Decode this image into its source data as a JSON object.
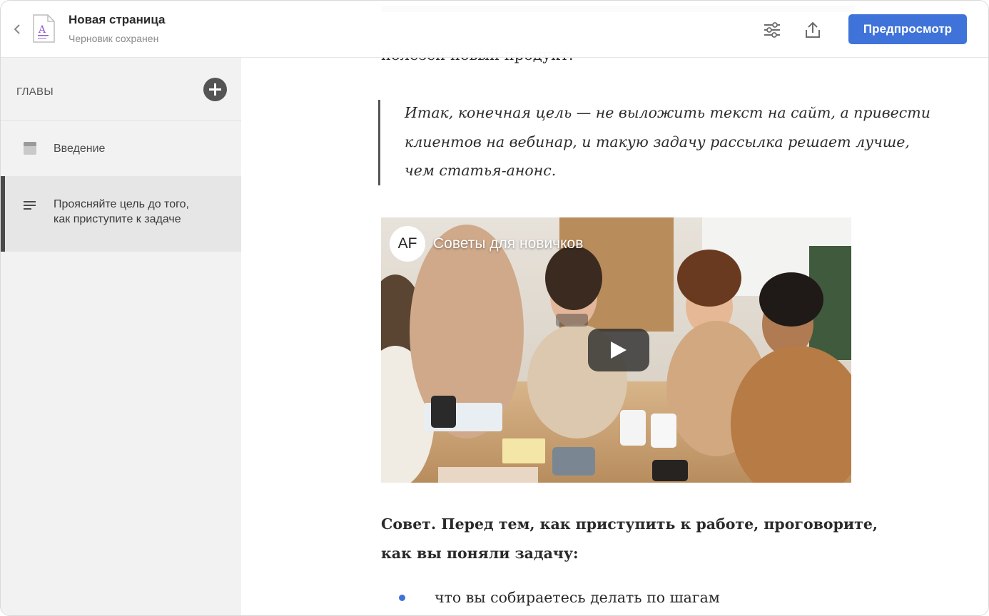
{
  "header": {
    "title": "Новая страница",
    "subtitle": "Черновик сохранен",
    "preview_label": "Предпросмотр",
    "doc_icon_letter": "A",
    "accent_color": "#3f73d9"
  },
  "sidebar": {
    "heading": "ГЛАВЫ",
    "chapters": [
      {
        "label": "Введение",
        "icon": "section-icon",
        "selected": false
      },
      {
        "label": "Проясняйте цель до того, как приступите к задаче",
        "line1": "Проясняйте цель до того,",
        "line2": "как приступите к задаче",
        "icon": "text-lines-icon",
        "selected": true
      }
    ]
  },
  "content": {
    "cut_line_top": "...",
    "cut_line_2": "полезен новый продукт.",
    "quote_lines": [
      "Итак, конечная цель — не выложить текст на сайт, а привести",
      "клиентов на вебинар, и такую задачу рассылка решает лучше,",
      "чем статья-анонс."
    ],
    "video": {
      "channel_initials": "AF",
      "title": "Советы для новичков"
    },
    "tip_lines": [
      "Совет. Перед тем, как приступить к работе, проговорите,",
      "как вы поняли задачу:"
    ],
    "bullets": [
      "что вы собираетесь делать по шагам"
    ]
  }
}
